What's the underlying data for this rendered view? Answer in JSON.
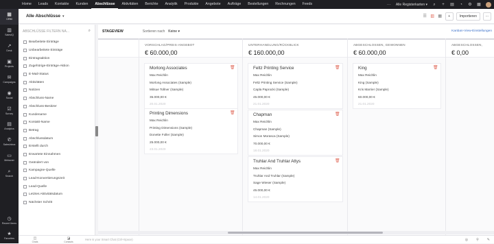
{
  "topnav": {
    "items": [
      "Home",
      "Leads",
      "Kontakte",
      "Kunden",
      "Abschlüsse",
      "Aktivitäten",
      "Berichte",
      "Analytik",
      "Produkte",
      "Angebote",
      "Aufträge",
      "Bestellungen",
      "Rechnungen",
      "Feeds"
    ],
    "active": "Abschlüsse",
    "more": "···",
    "all_registers": "Alle Registerkarten ▾"
  },
  "rail": {
    "items": [
      {
        "icon": "▦",
        "label": "CRM"
      },
      {
        "icon": "▥",
        "label": "SalesIQ"
      },
      {
        "icon": "↗",
        "label": "Desk"
      },
      {
        "icon": "▣",
        "label": "Projects"
      },
      {
        "icon": "✉",
        "label": "Campaigns"
      },
      {
        "icon": "◉",
        "label": "Social"
      },
      {
        "icon": "☑",
        "label": "Survey"
      },
      {
        "icon": "▤",
        "label": "Analytics"
      },
      {
        "icon": "✆",
        "label": "SalesInbox"
      },
      {
        "icon": "▭",
        "label": "Meissner"
      },
      {
        "icon": "⌕",
        "label": "Search"
      },
      {
        "icon": "◷",
        "label": "Recent Items"
      },
      {
        "icon": "★",
        "label": "Favorites"
      }
    ]
  },
  "header": {
    "view_title": "Alle Abschlüsse",
    "caret": "▾",
    "import_label": "Importieren",
    "plus_label": "+",
    "more_label": "···"
  },
  "filters": {
    "search_placeholder": "ABSCHLÜSSE FILTERN NA...",
    "items": [
      "Bearbeitete Einträge",
      "Unbearbeitete Einträge",
      "Eintragsaktion",
      "Zugehörige-Einträge-Aktion",
      "E-Mail-Status",
      "Aktivitäten",
      "Notizen",
      "Abschluss-Name",
      "Abschluss-Besitzer",
      "Kundename",
      "Kontakt-Name",
      "Betrag",
      "Abschlussdatum",
      "Erstellt durch",
      "Erwartete Einnahmen",
      "Geändert von",
      "Kampagne-Quelle",
      "Lead-Konvertierungszeit",
      "Lead-Quelle",
      "Letztes Aktivitätsdatum",
      "Nächster Schritt"
    ]
  },
  "board": {
    "stageview": "STAGEVIEW",
    "sort_label": "Sortieren nach",
    "sort_value": "Keine ▾",
    "kanban_settings": "Kanban-View-Einstellungen",
    "columns": [
      {
        "name": "...NTIFIZIEREN",
        "amount": "",
        "deals": []
      },
      {
        "name": "VORSCHLAG/PREIS-ANGEBOT",
        "amount": "€ 60.000,00",
        "deals": [
          {
            "name": "Morlong Associates",
            "owner": "Max Reichlin",
            "account": "Morlong Associates (Sample)",
            "contact": "Mitsue Tollner (Sample)",
            "amount": "35.000,00 €",
            "date": "20.01.2020"
          },
          {
            "name": "Printing Dimensions",
            "owner": "Max Reichlin",
            "account": "Printing Dimensions (Sample)",
            "contact": "Donette Foller (Sample)",
            "amount": "25.000,00 €",
            "date": "23.01.2020"
          }
        ]
      },
      {
        "name": "UNTERHANDLUNG/RÜCKBLICK",
        "amount": "€ 160.000,00",
        "deals": [
          {
            "name": "Feltz Printing Service",
            "owner": "Max Reichlin",
            "account": "Feltz Printing Service (Sample)",
            "contact": "Capla Paprocki (Sample)",
            "amount": "45.000,00 €",
            "date": "21.01.2020"
          },
          {
            "name": "Chapman",
            "owner": "Max Reichlin",
            "account": "Chapman (Sample)",
            "contact": "Simon Morasca (Sample)",
            "amount": "70.000,00 €",
            "date": "18.01.2020"
          },
          {
            "name": "Truhlar And Truhlar Attys",
            "owner": "Max Reichlin",
            "account": "Truhlar And Truhlar (Sample)",
            "contact": "Sage Wieser (Sample)",
            "amount": "45.000,00 €",
            "date": "14.01.2020"
          }
        ]
      },
      {
        "name": "ABGESCHLOSSEN, GEWONNEN",
        "amount": "€ 60.000,00",
        "deals": [
          {
            "name": "King",
            "owner": "Max Reichlin",
            "account": "King (Sample)",
            "contact": "Kris Marrier (Sample)",
            "amount": "60.000,00 €",
            "date": "21.01.2020"
          }
        ]
      },
      {
        "name": "ABGESCHLOSSEN,",
        "amount": "€ 0,00",
        "deals": []
      }
    ]
  },
  "bottombar": {
    "items": [
      {
        "icon": "◫",
        "label": "Chats"
      },
      {
        "icon": "◪",
        "label": "Contacts"
      }
    ],
    "chat_placeholder": "Here is your Smart Chat (Ctrl+Space)",
    "right_icons": [
      "◎",
      "⚲",
      "✎"
    ]
  },
  "colors": {
    "dark_nav": "#1f1f23",
    "link": "#3a6fc9",
    "delete": "#e06a5a"
  }
}
